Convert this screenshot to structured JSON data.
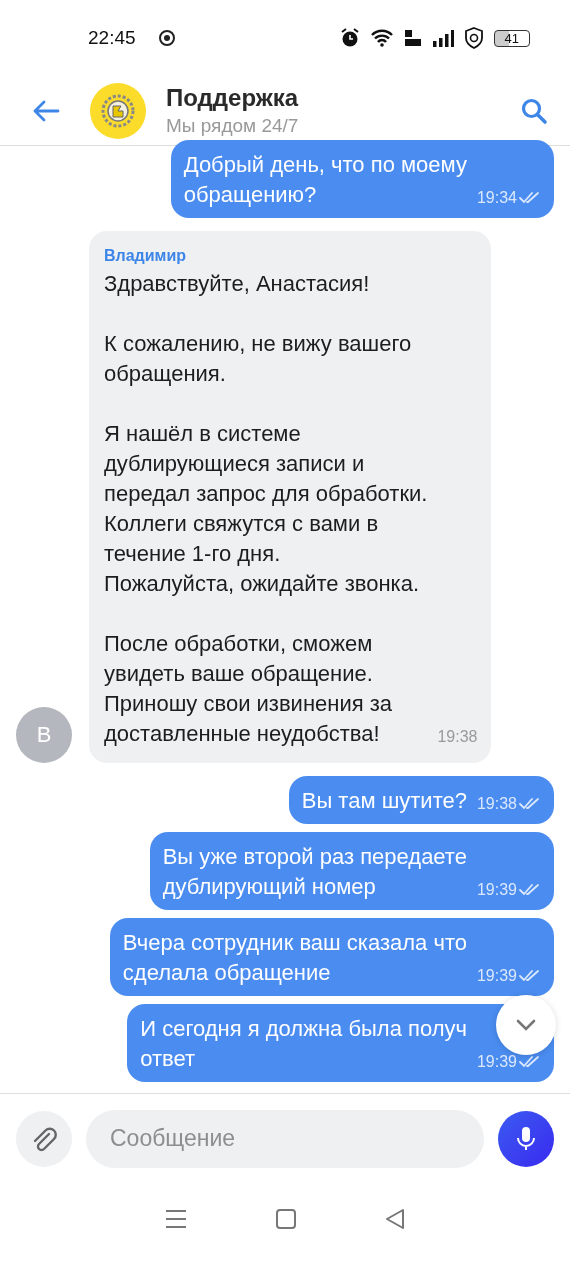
{
  "status_bar": {
    "time": "22:45",
    "battery": "41"
  },
  "header": {
    "title": "Поддержка",
    "subtitle": "Мы рядом 24/7"
  },
  "messages": [
    {
      "kind": "outgoing",
      "text": "Добрый день, что по моему\nобращению?",
      "time": "19:34",
      "read": true
    },
    {
      "kind": "incoming",
      "sender": "Владимир",
      "avatar": "В",
      "text": "Здравствуйте, Анастасия!\n\nК сожалению, не вижу вашего\nобращения.\n\nЯ нашёл в системе\nдублирующиеся записи и\nпередал запрос для обработки.\nКоллеги свяжутся с вами в\nтечение 1-го дня.\nПожалуйста, ожидайте звонка.\n\nПосле обработки, сможем\nувидеть ваше обращение.\nПриношу свои извинения за\nдоставленные неудобства!",
      "time": "19:38"
    },
    {
      "kind": "outgoing",
      "text": "Вы там шутите?",
      "time": "19:38",
      "read": true
    },
    {
      "kind": "outgoing",
      "text": "Вы уже второй раз передаете\nдублирующий номер",
      "time": "19:39",
      "read": true
    },
    {
      "kind": "outgoing",
      "text": "Вчера сотрудник ваш сказала что\nсделала обращение",
      "time": "19:39",
      "read": true
    },
    {
      "kind": "outgoing",
      "text": "И сегодня я должна была получ\nответ",
      "time": "19:39",
      "read": true
    }
  ],
  "composer": {
    "placeholder": "Сообщение"
  }
}
